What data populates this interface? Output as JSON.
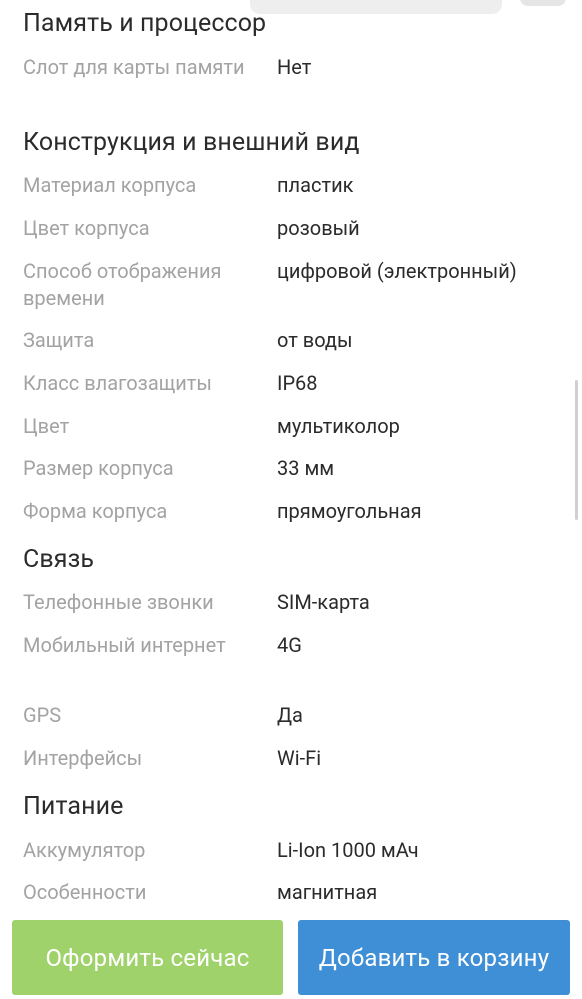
{
  "sections": {
    "memory": {
      "title": "Память и процессор",
      "rows": [
        {
          "label": "Слот для карты памяти",
          "value": "Нет"
        }
      ]
    },
    "design": {
      "title": "Конструкция и внешний вид",
      "rows": [
        {
          "label": "Материал корпуса",
          "value": "пластик"
        },
        {
          "label": "Цвет корпуса",
          "value": "розовый"
        },
        {
          "label": "Способ отображения времени",
          "value": "цифровой (электронный)"
        },
        {
          "label": "Защита",
          "value": "от воды"
        },
        {
          "label": "Класс влагозащиты",
          "value": "IP68"
        },
        {
          "label": "Цвет",
          "value": "мультиколор"
        },
        {
          "label": "Размер корпуса",
          "value": "33 мм"
        },
        {
          "label": "Форма корпуса",
          "value": "прямоугольная"
        }
      ]
    },
    "connectivity": {
      "title": "Связь",
      "rows": [
        {
          "label": "Телефонные звонки",
          "value": "SIM-карта"
        },
        {
          "label": "Мобильный интернет",
          "value": "4G"
        },
        {
          "label": "GPS",
          "value": "Да"
        },
        {
          "label": "Интерфейсы",
          "value": "Wi-Fi"
        }
      ]
    },
    "power": {
      "title": "Питание",
      "rows": [
        {
          "label": "Аккумулятор",
          "value": "Li-Ion 1000 мАч"
        },
        {
          "label": "Особенности",
          "value": "магнитная"
        }
      ]
    }
  },
  "actions": {
    "buy_now_label": "Оформить сейчас",
    "add_to_cart_label": "Добавить в корзину"
  },
  "colors": {
    "buy_now": "#a0d26c",
    "add_to_cart": "#3f8fd6",
    "label_text": "#a3a3a3",
    "value_text": "#2b2b2b"
  }
}
